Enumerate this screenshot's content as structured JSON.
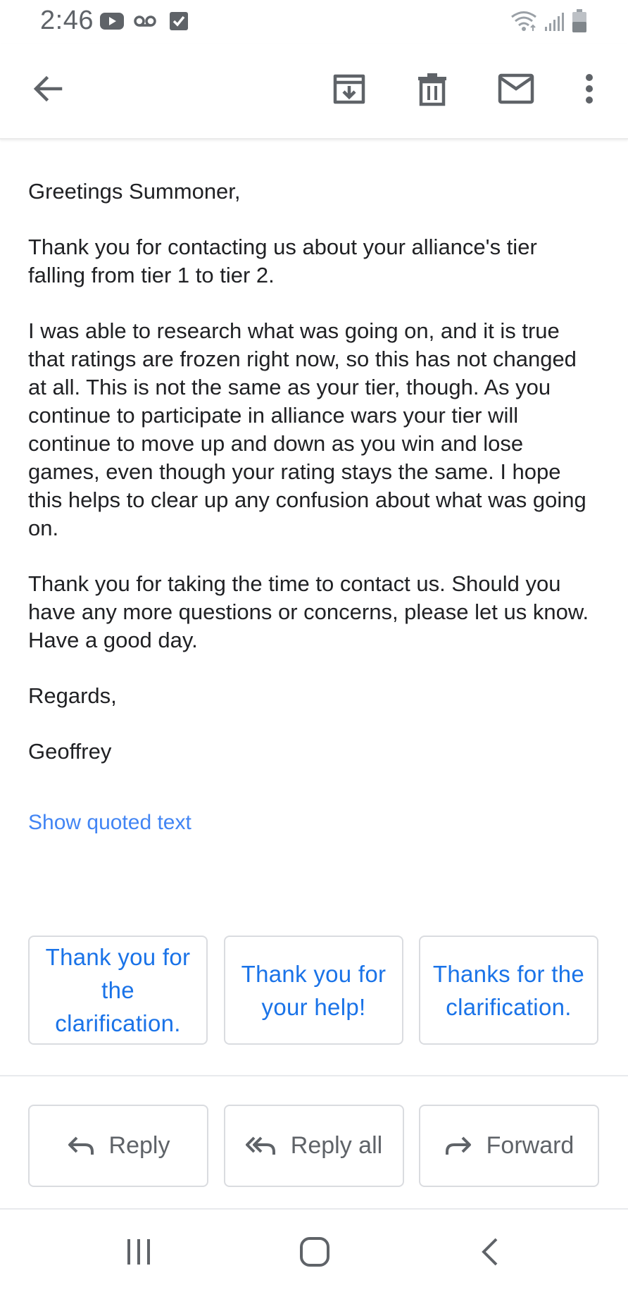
{
  "status_bar": {
    "time": "2:46",
    "icons": [
      "youtube-icon",
      "voicemail-icon",
      "checkbox-icon",
      "wifi-icon",
      "signal-icon",
      "battery-icon"
    ]
  },
  "toolbar": {
    "icons": [
      "back-arrow-icon",
      "archive-icon",
      "delete-icon",
      "mark-unread-icon",
      "more-vert-icon"
    ]
  },
  "email": {
    "greeting": "Greetings Summoner,",
    "paragraphs": [
      "Thank you for contacting us about your alliance's tier falling from tier 1 to tier 2.",
      "I was able to research what was going on, and it is true that ratings are frozen right now, so this has not changed at all. This is not the same as your tier, though. As you continue to participate in alliance wars your tier will continue to move up and down as you win and lose games, even though your rating stays the same. I hope this helps to clear up any confusion about what was going on.",
      "Thank you for taking the time to contact us. Should you have any more questions or concerns, please let us know. Have a good day."
    ],
    "closing": "Regards,",
    "signature": "Geoffrey",
    "show_quoted": "Show quoted text"
  },
  "smart_replies": [
    "Thank you for the clarification.",
    "Thank you for your help!",
    "Thanks for the clarification."
  ],
  "actions": {
    "reply": "Reply",
    "reply_all": "Reply all",
    "forward": "Forward"
  },
  "colors": {
    "link": "#4285f4",
    "smart_reply_text": "#1a73e8",
    "icon_gray": "#5f6368",
    "border": "#dadce0"
  }
}
